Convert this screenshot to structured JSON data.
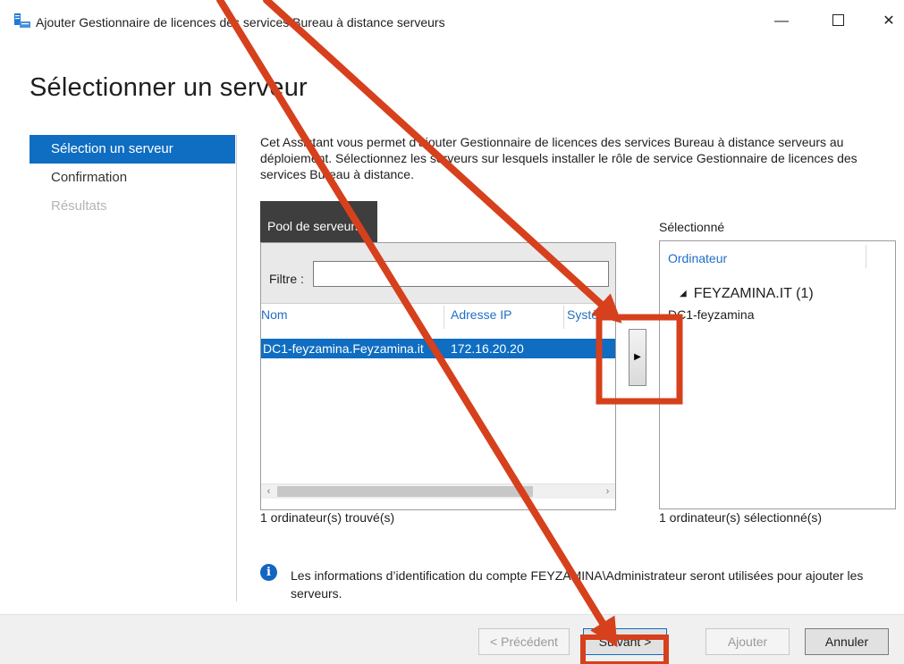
{
  "window": {
    "title": "Ajouter Gestionnaire de licences des services Bureau à distance serveurs",
    "minimize_glyph": "—",
    "close_glyph": "✕",
    "icon": "server-app-icon"
  },
  "page": {
    "title": "Sélectionner un serveur",
    "description": "Cet Assistant vous permet d'ajouter Gestionnaire de licences des services Bureau à distance serveurs au déploiement. Sélectionnez les serveurs sur lesquels installer le rôle de service Gestionnaire de licences des services Bureau à distance."
  },
  "nav": {
    "items": [
      {
        "label": "Sélection un serveur",
        "state": "active"
      },
      {
        "label": "Confirmation",
        "state": "normal"
      },
      {
        "label": "Résultats",
        "state": "disabled"
      }
    ]
  },
  "pool": {
    "tab_label": "Pool de serveurs",
    "filter_label": "Filtre :",
    "filter_value": "",
    "columns": {
      "name": "Nom",
      "ip": "Adresse IP",
      "system": "Système d'exploitation"
    },
    "rows": [
      {
        "name": "DC1-feyzamina.Feyzamina.it",
        "ip": "172.16.20.20"
      }
    ],
    "count_text": "1 ordinateur(s) trouvé(s)",
    "scroll_left_glyph": "‹",
    "scroll_right_glyph": "›"
  },
  "add_arrow": {
    "glyph": "▶"
  },
  "selected": {
    "label": "Sélectionné",
    "column": "Ordinateur",
    "group_glyph": "◢",
    "group": "FEYZAMINA.IT (1)",
    "items": [
      "DC1-feyzamina"
    ],
    "count_text": "1 ordinateur(s) sélectionné(s)"
  },
  "info": {
    "icon_glyph": "i",
    "text": "Les informations d’identification du compte FEYZAMINA\\Administrateur seront utilisées pour ajouter les serveurs."
  },
  "footer": {
    "prev_label": "< Précédent",
    "next_label": "Suivant >",
    "add_label": "Ajouter",
    "cancel_label": "Annuler"
  },
  "colors": {
    "accent": "#0f6dc2",
    "header_link": "#1f6fc5",
    "pool_tab": "#3e3e3e",
    "annotation": "#d6401c"
  }
}
